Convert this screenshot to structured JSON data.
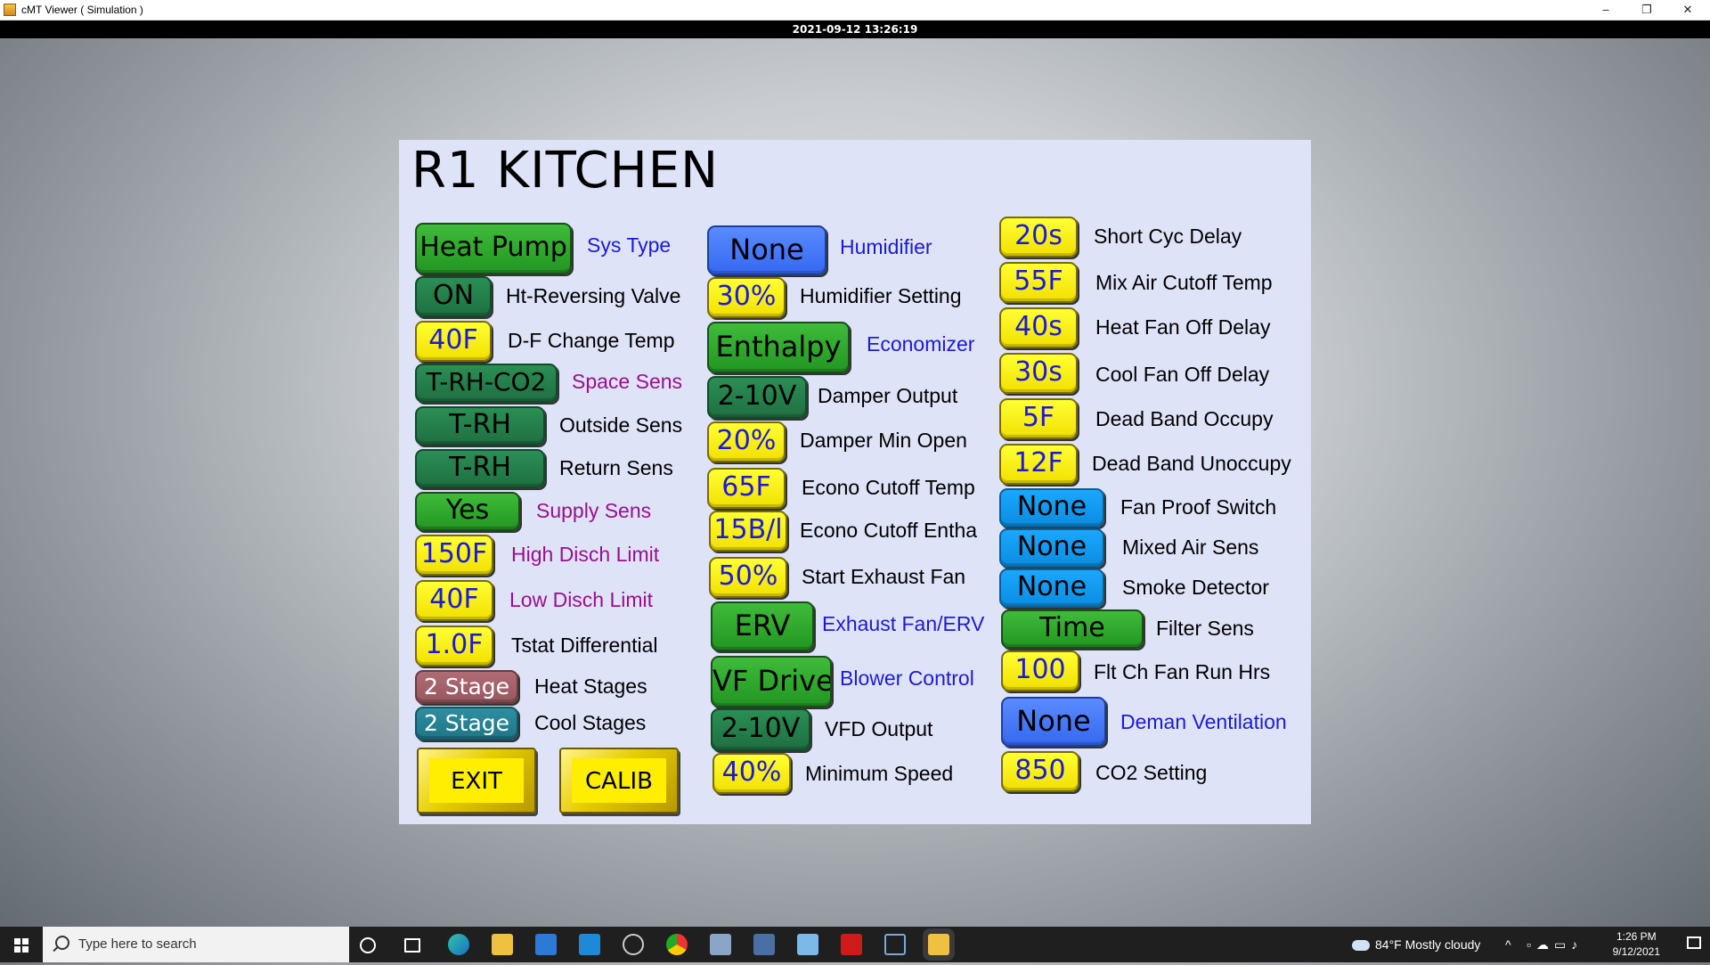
{
  "window": {
    "title": "cMT Viewer ( Simulation )",
    "min_glyph": "–",
    "restore_glyph": "❐",
    "close_glyph": "✕"
  },
  "datetime": "2021-09-12 13:26:19",
  "panel": {
    "title": "R1  KITCHEN",
    "col1": [
      {
        "value": "Heat Pump",
        "label": "Sys Type"
      },
      {
        "value": "ON",
        "label": "Ht-Reversing Valve"
      },
      {
        "value": "40F",
        "label": "D-F Change Temp"
      },
      {
        "value": "T-RH-CO2",
        "label": "Space Sens"
      },
      {
        "value": "T-RH",
        "label": "Outside Sens"
      },
      {
        "value": "T-RH",
        "label": "Return Sens"
      },
      {
        "value": "Yes",
        "label": "Supply Sens"
      },
      {
        "value": "150F",
        "label": "High Disch Limit"
      },
      {
        "value": "40F",
        "label": "Low Disch Limit"
      },
      {
        "value": "1.0F",
        "label": "Tstat Differential"
      },
      {
        "value": "2 Stage",
        "label": "Heat Stages"
      },
      {
        "value": "2 Stage",
        "label": "Cool Stages"
      }
    ],
    "col2": [
      {
        "value": "None",
        "label": "Humidifier"
      },
      {
        "value": "30%",
        "label": "Humidifier Setting"
      },
      {
        "value": "Enthalpy",
        "label": "Economizer"
      },
      {
        "value": "2-10V",
        "label": "Damper Output"
      },
      {
        "value": "20%",
        "label": "Damper Min Open"
      },
      {
        "value": "65F",
        "label": "Econo Cutoff Temp"
      },
      {
        "value": "15B/l",
        "label": "Econo Cutoff Entha"
      },
      {
        "value": "50%",
        "label": "Start Exhaust Fan"
      },
      {
        "value": "ERV",
        "label": "Exhaust Fan/ERV"
      },
      {
        "value": "VF Drive",
        "label": "Blower Control"
      },
      {
        "value": "2-10V",
        "label": "VFD Output"
      },
      {
        "value": "40%",
        "label": "Minimum Speed"
      }
    ],
    "col3": [
      {
        "value": "20s",
        "label": "Short Cyc Delay"
      },
      {
        "value": "55F",
        "label": "Mix Air Cutoff Temp"
      },
      {
        "value": "40s",
        "label": "Heat Fan Off Delay"
      },
      {
        "value": "30s",
        "label": "Cool Fan Off Delay"
      },
      {
        "value": "5F",
        "label": "Dead Band Occupy"
      },
      {
        "value": "12F",
        "label": "Dead Band Unoccupy"
      },
      {
        "value": "None",
        "label": "Fan Proof Switch"
      },
      {
        "value": "None",
        "label": "Mixed Air Sens"
      },
      {
        "value": "None",
        "label": "Smoke Detector"
      },
      {
        "value": "Time",
        "label": "Filter Sens"
      },
      {
        "value": "100",
        "label": "Flt Ch Fan Run Hrs"
      },
      {
        "value": "None",
        "label": "Deman Ventilation"
      },
      {
        "value": "850",
        "label": "CO2 Setting"
      }
    ],
    "exit_label": "EXIT",
    "calib_label": "CALIB"
  },
  "colors": {
    "yellow": "#ffff33",
    "green": "#3fbb3a",
    "dark_green": "#2a8f55",
    "blue": "#5a8bff",
    "cyan": "#1aa7ff",
    "mauve": "#b06c74",
    "teal": "#2d8fa1",
    "label_blue": "#1b1bd6",
    "label_purple": "#9a0f8f",
    "panel_bg": "#dfe3f8"
  },
  "taskbar": {
    "search_placeholder": "Type here to search",
    "weather": "84°F  Mostly cloudy",
    "time": "1:26 PM",
    "date": "9/12/2021",
    "icons": [
      "cortana-icon",
      "task-view-icon",
      "edge-icon",
      "file-explorer-icon",
      "store-icon",
      "mail-icon",
      "dell-icon",
      "chrome-icon",
      "app-icon",
      "shield-app-icon",
      "tool-icon",
      "acrobat-icon",
      "remote-icon",
      "cmt-viewer-icon"
    ]
  }
}
